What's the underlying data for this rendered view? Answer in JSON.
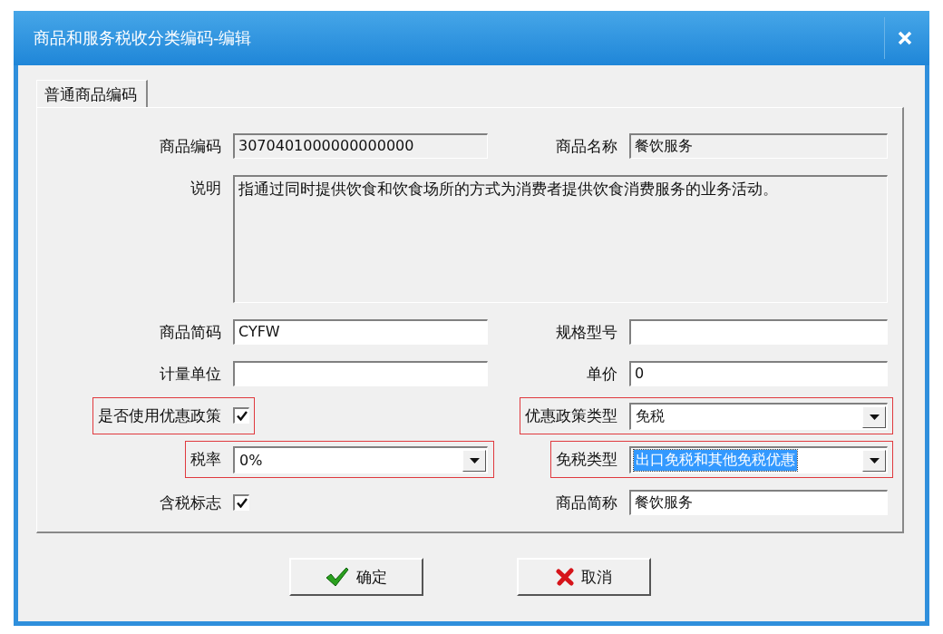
{
  "window": {
    "title": "商品和服务税收分类编码-编辑"
  },
  "tabs": [
    {
      "label": "普通商品编码",
      "selected": true
    }
  ],
  "rows": [
    [
      {
        "kind": "readonly",
        "label": "商品编码",
        "value": "3070401000000000000"
      },
      {
        "kind": "readonly",
        "label": "商品名称",
        "value": "餐饮服务"
      }
    ],
    [
      {
        "kind": "textarea",
        "label": "说明",
        "value": "指通过同时提供饮食和饮食场所的方式为消费者提供饮食消费服务的业务活动。"
      }
    ],
    [
      {
        "kind": "text",
        "label": "商品简码",
        "value": "CYFW"
      },
      {
        "kind": "text",
        "label": "规格型号"
      }
    ],
    [
      {
        "kind": "text",
        "label": "计量单位"
      },
      {
        "kind": "text",
        "label": "单价",
        "value": "0"
      }
    ],
    [
      {
        "kind": "checkbox",
        "label": "是否使用优惠政策",
        "checked": true,
        "highlighted": true
      },
      {
        "kind": "select",
        "label": "优惠政策类型",
        "value": "免税",
        "highlighted": true,
        "text_selected": false
      }
    ],
    [
      {
        "kind": "select",
        "label": "税率",
        "value": "0%",
        "highlighted": true,
        "text_selected": false
      },
      {
        "kind": "select",
        "label": "免税类型",
        "value": "出口免税和其他免税优惠",
        "highlighted": true,
        "text_selected": true
      }
    ],
    [
      {
        "kind": "checkbox",
        "label": "含税标志",
        "checked": true
      },
      {
        "kind": "text",
        "label": "商品简称",
        "value": "餐饮服务"
      }
    ]
  ],
  "buttons": [
    {
      "kind": "ok",
      "label": "确定"
    },
    {
      "kind": "cancel",
      "label": "取消"
    }
  ]
}
